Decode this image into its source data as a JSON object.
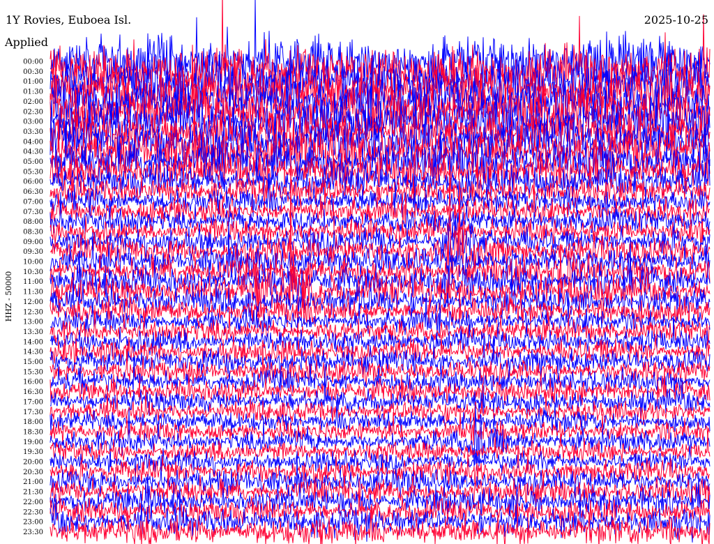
{
  "header": {
    "station": "1Y Rovies, Euboea Isl.",
    "date": "2025-10-25",
    "filter_note": "Applied"
  },
  "colors": {
    "trace_a": "#0000ff",
    "trace_b": "#ff0033",
    "background": "#ffffff",
    "text": "#000000"
  },
  "chart_data": {
    "type": "line",
    "title": "1Y Rovies, Euboea Isl.",
    "subtitle": "2025-10-25",
    "ylabel": "HHZ - 50000",
    "xlabel": "",
    "grid": false,
    "legend": "none",
    "row_labels": [
      "00:00",
      "00:30",
      "01:00",
      "01:30",
      "02:00",
      "02:30",
      "03:00",
      "03:30",
      "04:00",
      "04:30",
      "05:00",
      "05:30",
      "06:00",
      "06:30",
      "07:00",
      "07:30",
      "08:00",
      "08:30",
      "09:00",
      "09:30",
      "10:00",
      "10:30",
      "11:00",
      "11:30",
      "12:00",
      "12:30",
      "13:00",
      "13:30",
      "14:00",
      "14:30",
      "15:00",
      "15:30",
      "16:00",
      "16:30",
      "17:00",
      "17:30",
      "18:00",
      "18:30",
      "19:00",
      "19:30",
      "20:00",
      "20:30",
      "21:00",
      "21:30",
      "22:00",
      "22:30",
      "23:00",
      "23:30"
    ],
    "row_colors": [
      "trace_a",
      "trace_b"
    ],
    "row_amplitude": [
      3.0,
      3.0,
      3.0,
      3.0,
      3.0,
      2.9,
      2.8,
      2.7,
      2.6,
      2.5,
      2.3,
      2.1,
      1.9,
      1.6,
      1.5,
      1.5,
      1.4,
      1.4,
      1.5,
      1.6,
      1.6,
      1.5,
      1.7,
      1.8,
      1.6,
      1.5,
      1.3,
      1.3,
      1.4,
      1.4,
      1.4,
      1.3,
      1.3,
      1.3,
      1.3,
      1.2,
      1.2,
      1.2,
      1.2,
      1.2,
      1.2,
      1.3,
      1.4,
      1.4,
      1.5,
      1.5,
      1.6,
      1.6
    ],
    "events": [
      {
        "row": 18,
        "x_frac": 0.6,
        "strength": 2.2
      },
      {
        "row": 19,
        "x_frac": 0.61,
        "strength": 1.8
      },
      {
        "row": 21,
        "x_frac": 0.78,
        "strength": 2.0
      },
      {
        "row": 23,
        "x_frac": 0.32,
        "strength": 2.0
      },
      {
        "row": 23,
        "x_frac": 0.37,
        "strength": 1.8
      },
      {
        "row": 38,
        "x_frac": 0.65,
        "strength": 2.4
      }
    ]
  }
}
